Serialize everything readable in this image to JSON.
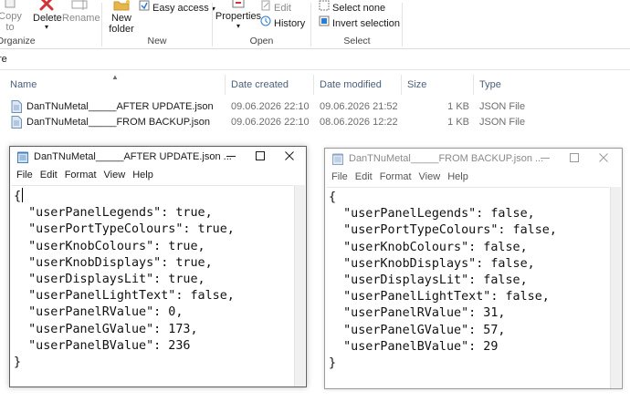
{
  "ribbon": {
    "clipboard": {
      "copy_label": "Copy",
      "copy_label2": "to",
      "group_label": "Organize"
    },
    "organize": {
      "delete_label": "Delete",
      "rename_label": "Rename",
      "group_label": "Organize"
    },
    "new": {
      "new_folder_label": "New",
      "new_folder_label2": "folder",
      "easy_access_label": "Easy access",
      "group_label": "New"
    },
    "open": {
      "properties_label": "Properties",
      "edit_label": "Edit",
      "history_label": "History",
      "group_label": "Open"
    },
    "select": {
      "select_none_label": "Select none",
      "invert_selection_label": "Invert selection",
      "group_label": "Select"
    }
  },
  "address": {
    "path_fragment": "re"
  },
  "file_list": {
    "columns": [
      "Name",
      "Date created",
      "Date modified",
      "Size",
      "Type"
    ],
    "rows": [
      {
        "name": "DanTNuMetal_____AFTER UPDATE.json",
        "created": "09.06.2026 22:10",
        "modified": "09.06.2026 21:52",
        "size": "1 KB",
        "type": "JSON File"
      },
      {
        "name": "DanTNuMetal_____FROM BACKUP.json",
        "created": "09.06.2026 22:10",
        "modified": "08.06.2026 12:22",
        "size": "1 KB",
        "type": "JSON File"
      }
    ]
  },
  "notepad_after": {
    "title": "DanTNuMetal_____AFTER UPDATE.json ...",
    "menu": [
      "File",
      "Edit",
      "Format",
      "View",
      "Help"
    ],
    "lines": [
      "{",
      "  \"userPanelLegends\": true,",
      "  \"userPortTypeColours\": true,",
      "  \"userKnobColours\": true,",
      "  \"userKnobDisplays\": true,",
      "  \"userDisplaysLit\": true,",
      "  \"userPanelLightText\": false,",
      "  \"userPanelRValue\": 0,",
      "  \"userPanelGValue\": 173,",
      "  \"userPanelBValue\": 236",
      "}"
    ]
  },
  "notepad_backup": {
    "title": "DanTNuMetal_____FROM BACKUP.json ...",
    "menu": [
      "File",
      "Edit",
      "Format",
      "View",
      "Help"
    ],
    "lines": [
      "{",
      "  \"userPanelLegends\": false,",
      "  \"userPortTypeColours\": false,",
      "  \"userKnobColours\": false,",
      "  \"userKnobDisplays\": false,",
      "  \"userDisplaysLit\": false,",
      "  \"userPanelLightText\": false,",
      "  \"userPanelRValue\": 31,",
      "  \"userPanelGValue\": 57,",
      "  \"userPanelBValue\": 29",
      "}"
    ]
  },
  "icons": [
    "copy-icon",
    "delete-icon",
    "rename-icon",
    "new-folder-icon",
    "easy-access-icon",
    "properties-icon",
    "edit-icon",
    "history-icon",
    "select-none-icon",
    "invert-selection-icon",
    "json-file-icon",
    "notepad-icon",
    "minimize-icon",
    "maximize-icon",
    "close-icon",
    "sort-ascending-icon"
  ],
  "colors": {
    "column_header_text": "#4c607a",
    "delete_red": "#d13438",
    "folder_yellow": "#e8b54a",
    "accent_blue": "#2b7cd3"
  }
}
